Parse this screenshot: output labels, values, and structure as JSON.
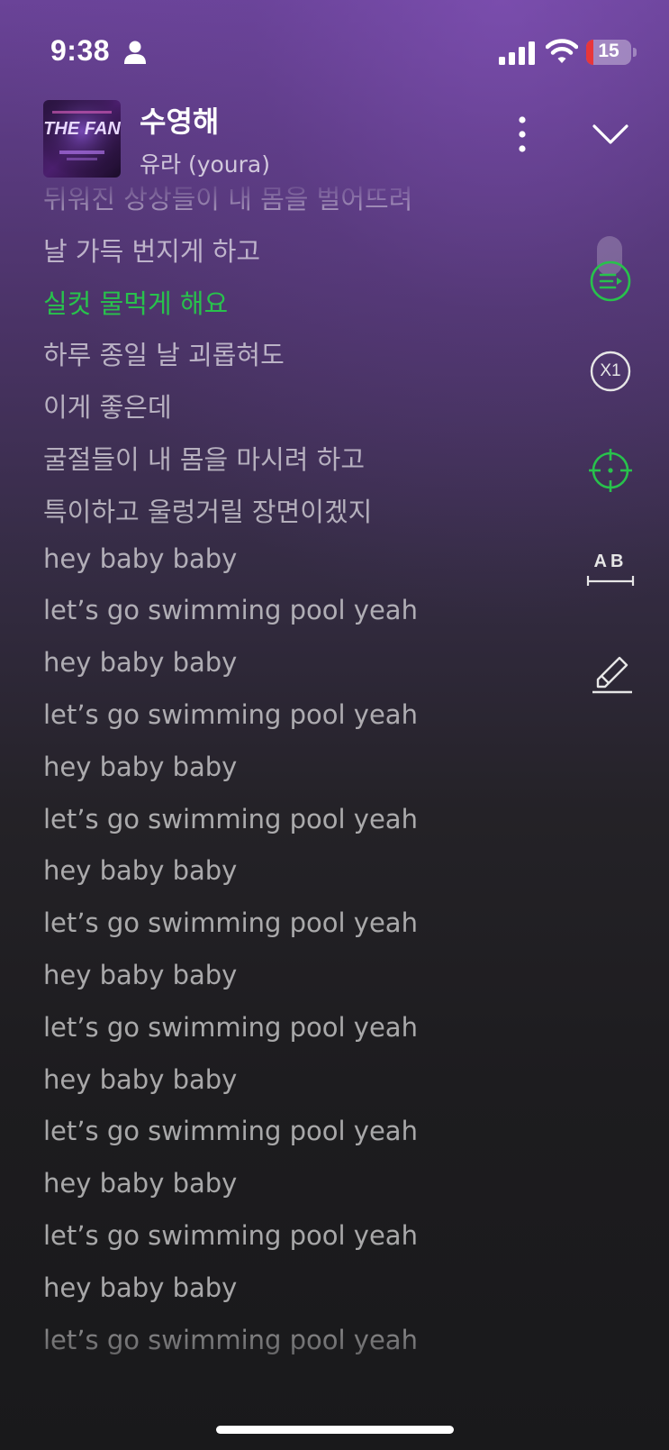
{
  "status_bar": {
    "time": "9:38",
    "battery_percent": "15",
    "battery_level": 0.15
  },
  "header": {
    "album_art_text": "THE FAN",
    "title": "수영해",
    "artist": "유라 (youra)"
  },
  "lyrics": {
    "active_index": 2,
    "lines": [
      "뒤워진 상상들이 내 몸을 벌어뜨려",
      "날 가득 번지게 하고",
      "실컷 물먹게 해요",
      "하루 종일 날 괴롭혀도",
      "이게 좋은데",
      "굴절들이 내 몸을 마시려 하고",
      "특이하고 울렁거릴 장면이겠지",
      "hey baby baby",
      "let’s go swimming pool yeah",
      "hey baby baby",
      "let’s go swimming pool yeah",
      "hey baby baby",
      "let’s go swimming pool yeah",
      "hey baby baby",
      "let’s go swimming pool yeah",
      "hey baby baby",
      "let’s go swimming pool yeah",
      "hey baby baby",
      "let’s go swimming pool yeah",
      "hey baby baby",
      "let’s go swimming pool yeah",
      "hey baby baby",
      "let’s go swimming pool yeah"
    ]
  },
  "side_controls": {
    "speed_label": "X1",
    "ab_repeat_label": "AB"
  },
  "colors": {
    "accent": "#28c24c",
    "battery_low": "#e8363a"
  },
  "icons": [
    "person-icon",
    "signal-icon",
    "wifi-icon",
    "more-vertical-icon",
    "chevron-down-icon",
    "playlist-icon",
    "speed-icon",
    "locate-icon",
    "ab-repeat-icon",
    "highlighter-icon"
  ]
}
